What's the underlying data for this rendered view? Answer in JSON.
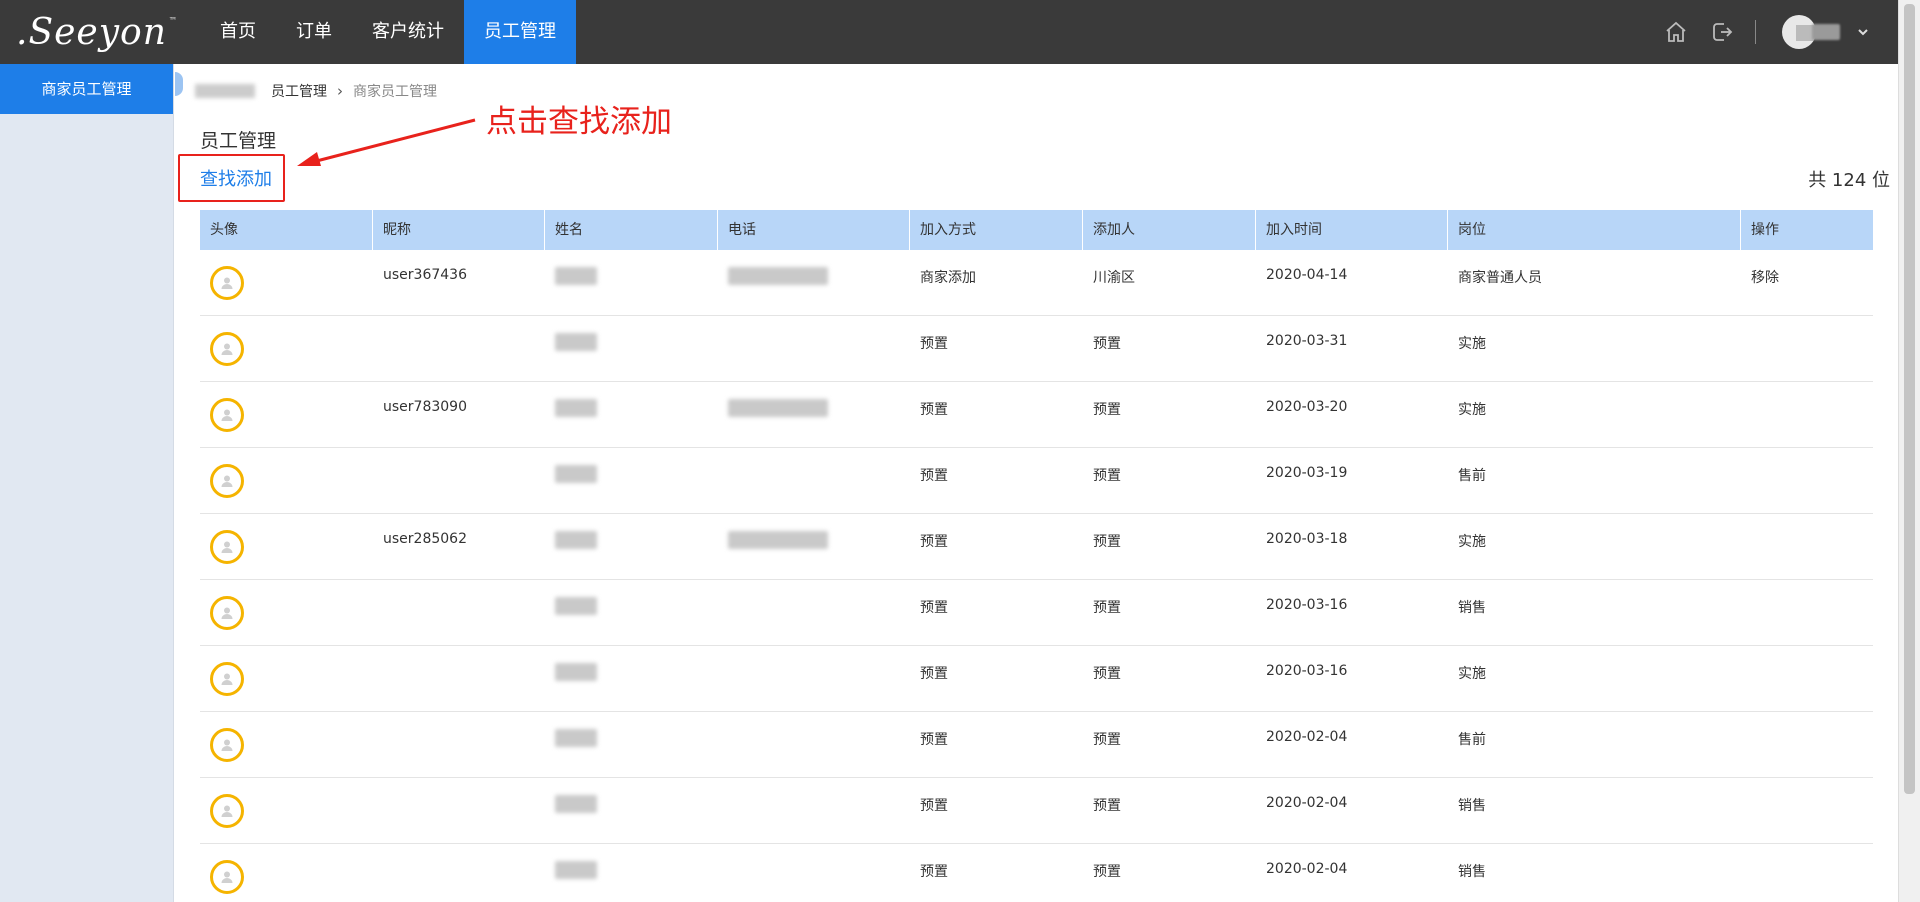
{
  "app": {
    "logo_text": ".Seeyon",
    "logo_tm": "™"
  },
  "nav": {
    "items": [
      {
        "label": "首页"
      },
      {
        "label": "订单"
      },
      {
        "label": "客户统计"
      },
      {
        "label": "员工管理",
        "active": true
      }
    ]
  },
  "topbar_icons": [
    "home-icon",
    "logout-icon",
    "chevron-down-icon"
  ],
  "sidebar": {
    "items": [
      {
        "label": "商家员工管理",
        "active": true
      }
    ]
  },
  "breadcrumb": {
    "items": [
      "员工管理",
      "商家员工管理"
    ]
  },
  "page": {
    "title": "员工管理",
    "find_add": "查找添加",
    "total": "共 124 位",
    "annotation": "点击查找添加"
  },
  "table": {
    "columns": [
      "头像",
      "昵称",
      "姓名",
      "电话",
      "加入方式",
      "添加人",
      "加入时间",
      "岗位",
      "操作"
    ],
    "rows": [
      {
        "nickname": "user367436",
        "phone_shown": true,
        "join_method": "商家添加",
        "added_by": "川渝区",
        "join_time": "2020-04-14",
        "position": "商家普通人员",
        "action": "移除"
      },
      {
        "nickname": "",
        "phone_shown": false,
        "join_method": "预置",
        "added_by": "预置",
        "join_time": "2020-03-31",
        "position": "实施",
        "action": ""
      },
      {
        "nickname": "user783090",
        "phone_shown": true,
        "join_method": "预置",
        "added_by": "预置",
        "join_time": "2020-03-20",
        "position": "实施",
        "action": ""
      },
      {
        "nickname": "",
        "phone_shown": false,
        "join_method": "预置",
        "added_by": "预置",
        "join_time": "2020-03-19",
        "position": "售前",
        "action": ""
      },
      {
        "nickname": "user285062",
        "phone_shown": true,
        "join_method": "预置",
        "added_by": "预置",
        "join_time": "2020-03-18",
        "position": "实施",
        "action": ""
      },
      {
        "nickname": "",
        "phone_shown": false,
        "join_method": "预置",
        "added_by": "预置",
        "join_time": "2020-03-16",
        "position": "销售",
        "action": ""
      },
      {
        "nickname": "",
        "phone_shown": false,
        "join_method": "预置",
        "added_by": "预置",
        "join_time": "2020-03-16",
        "position": "实施",
        "action": ""
      },
      {
        "nickname": "",
        "phone_shown": false,
        "join_method": "预置",
        "added_by": "预置",
        "join_time": "2020-02-04",
        "position": "售前",
        "action": ""
      },
      {
        "nickname": "",
        "phone_shown": false,
        "join_method": "预置",
        "added_by": "预置",
        "join_time": "2020-02-04",
        "position": "销售",
        "action": ""
      },
      {
        "nickname": "",
        "phone_shown": false,
        "join_method": "预置",
        "added_by": "预置",
        "join_time": "2020-02-04",
        "position": "销售",
        "action": ""
      }
    ]
  },
  "colors": {
    "accent": "#1e7ee8",
    "topbar": "#3a3a3a",
    "header_row": "#b8d6f8",
    "annotation": "#e8221c",
    "avatar_ring": "#f5b400"
  }
}
